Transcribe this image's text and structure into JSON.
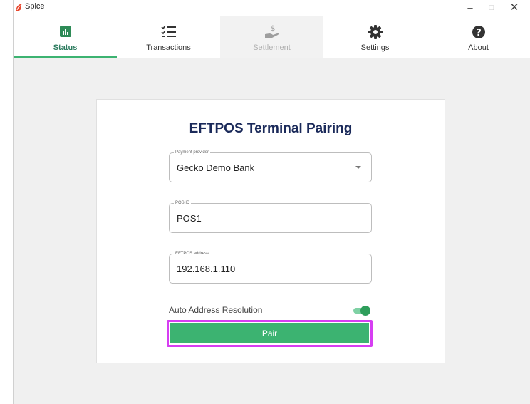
{
  "window": {
    "title": "Spice",
    "controls": {
      "minimize": "–",
      "maximize": "□",
      "close": "✕"
    }
  },
  "tabs": [
    {
      "label": "Status",
      "icon": "bar-chart-icon",
      "active": true
    },
    {
      "label": "Transactions",
      "icon": "checklist-icon",
      "active": false
    },
    {
      "label": "Settlement",
      "icon": "hand-dollar-icon",
      "active": false,
      "disabled": true
    },
    {
      "label": "Settings",
      "icon": "gear-icon",
      "active": false
    },
    {
      "label": "About",
      "icon": "help-circle-icon",
      "active": false
    }
  ],
  "pairing": {
    "title": "EFTPOS Terminal Pairing",
    "provider": {
      "label": "Payment provider",
      "value": "Gecko Demo Bank"
    },
    "pos_id": {
      "label": "POS ID",
      "value": "POS1"
    },
    "address": {
      "label": "EFTPOS address",
      "value": "192.168.1.110"
    },
    "auto_resolution": {
      "label": "Auto Address Resolution",
      "enabled": true
    },
    "pair_button": "Pair"
  },
  "colors": {
    "accent": "#3cb371",
    "title": "#1b2a5a",
    "highlight": "#d63ef2"
  }
}
